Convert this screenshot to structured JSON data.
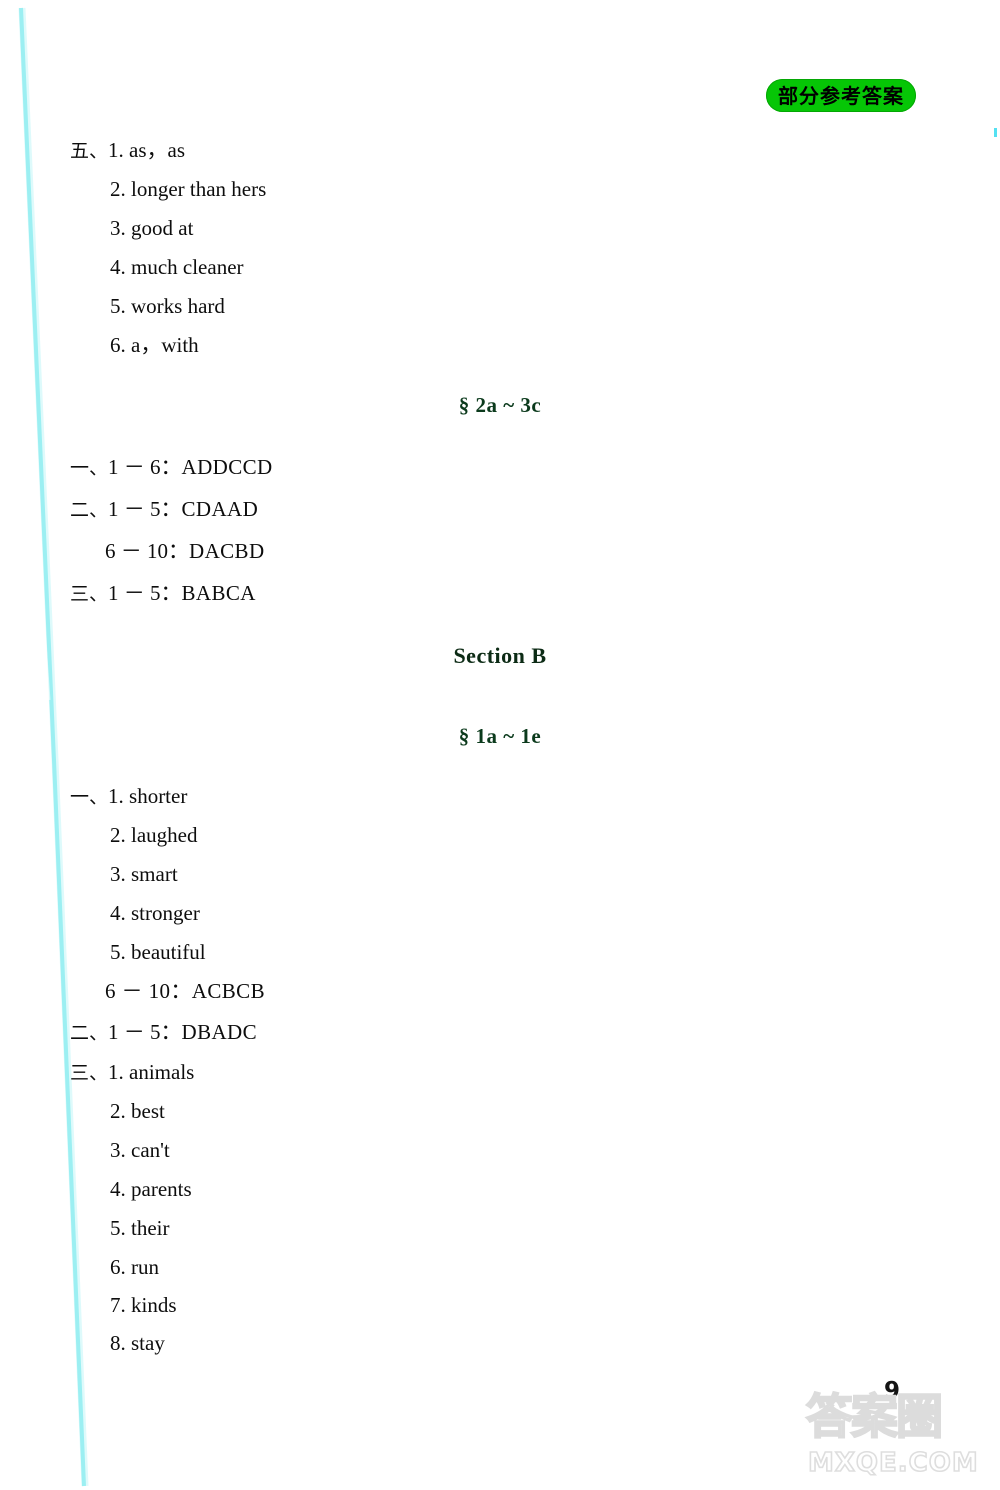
{
  "header": {
    "badge_label": "部分参考答案"
  },
  "footer": {
    "page_number": "9",
    "watermark_logo": "答案圈",
    "watermark_domain": "MXQE.COM"
  },
  "blocks": {
    "group_five": {
      "marker": "五、",
      "items": [
        "1. as，as",
        "2. longer than hers",
        "3. good at",
        "4. much cleaner",
        "5. works hard",
        "6. a，with"
      ]
    },
    "heading_2a_3c": "§ 2a ~ 3c",
    "group_one_a": {
      "marker": "一、",
      "line": "1 － 6："
    },
    "group_one_a_answers": "ADDCCD",
    "group_two_a": {
      "marker": "二、",
      "line": "1 － 5：",
      "answers": "CDAAD",
      "line2": "6 － 10：",
      "answers2": "DACBD"
    },
    "group_three_a": {
      "marker": "三、",
      "line": "1 － 5：",
      "answers": "BABCA"
    },
    "heading_section_b": "Section B",
    "heading_1a_1e": "§ 1a ~ 1e",
    "group_one_b": {
      "marker": "一、",
      "items": [
        "1. shorter",
        "2. laughed",
        "3. smart",
        "4. stronger",
        "5. beautiful"
      ],
      "range_line": "6 － 10：ACBCB"
    },
    "group_two_b": {
      "marker": "二、",
      "line": "1 － 5：",
      "answers": "DBADC"
    },
    "group_three_b": {
      "marker": "三、",
      "items": [
        "1. animals",
        "2. best",
        "3. can't",
        "4. parents",
        "5. their",
        "6. run",
        "7. kinds",
        "8. stay"
      ]
    }
  },
  "colors": {
    "badge_green": "#06c606",
    "heading_green": "#0b3a1c",
    "scan_edge_cyan": "#36dcf0",
    "watermark_gray": "#dcdcdc"
  }
}
